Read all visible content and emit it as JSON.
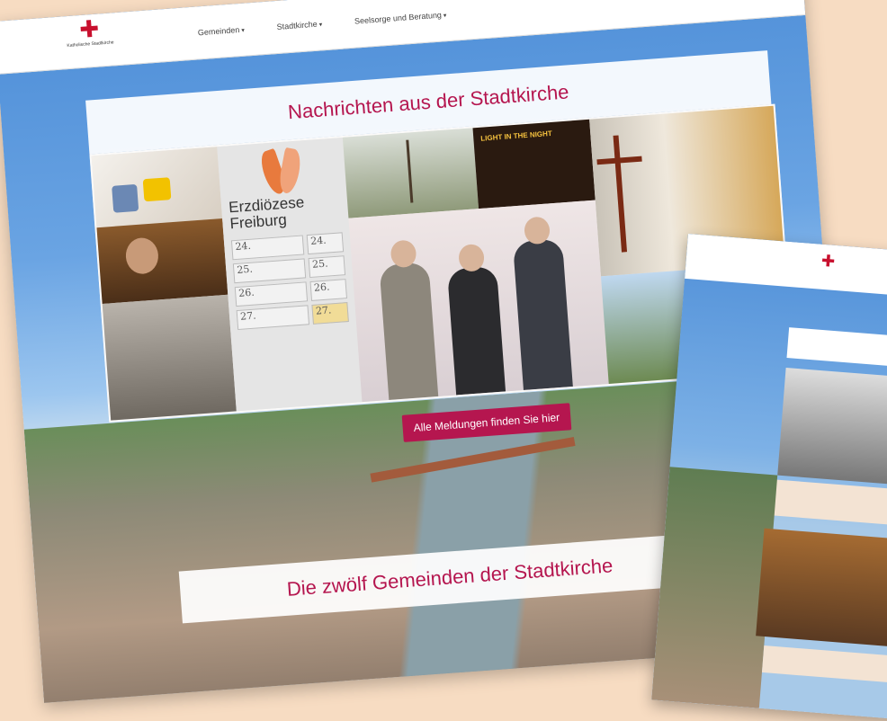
{
  "nav": {
    "items": [
      "Gemeinden",
      "Stadtkirche",
      "Seelsorge und Beratung"
    ],
    "logo_text": "Katholische Stadtkirche"
  },
  "news": {
    "title": "Nachrichten aus der Stadtkirche",
    "cta_label": "Alle Meldungen finden Sie hier",
    "erzdioezese_text": "Erzdiözese Freiburg",
    "light_text": "LIGHT IN THE NIGHT",
    "calendar": [
      [
        "24.",
        "24."
      ],
      [
        "25.",
        "25."
      ],
      [
        "26.",
        "26."
      ],
      [
        "27.",
        "27."
      ]
    ]
  },
  "gemeinden": {
    "title": "Die zwölf Gemeinden der Stadtkirche"
  },
  "colors": {
    "accent": "#b5164f",
    "logo_cross": "#c8102e"
  }
}
